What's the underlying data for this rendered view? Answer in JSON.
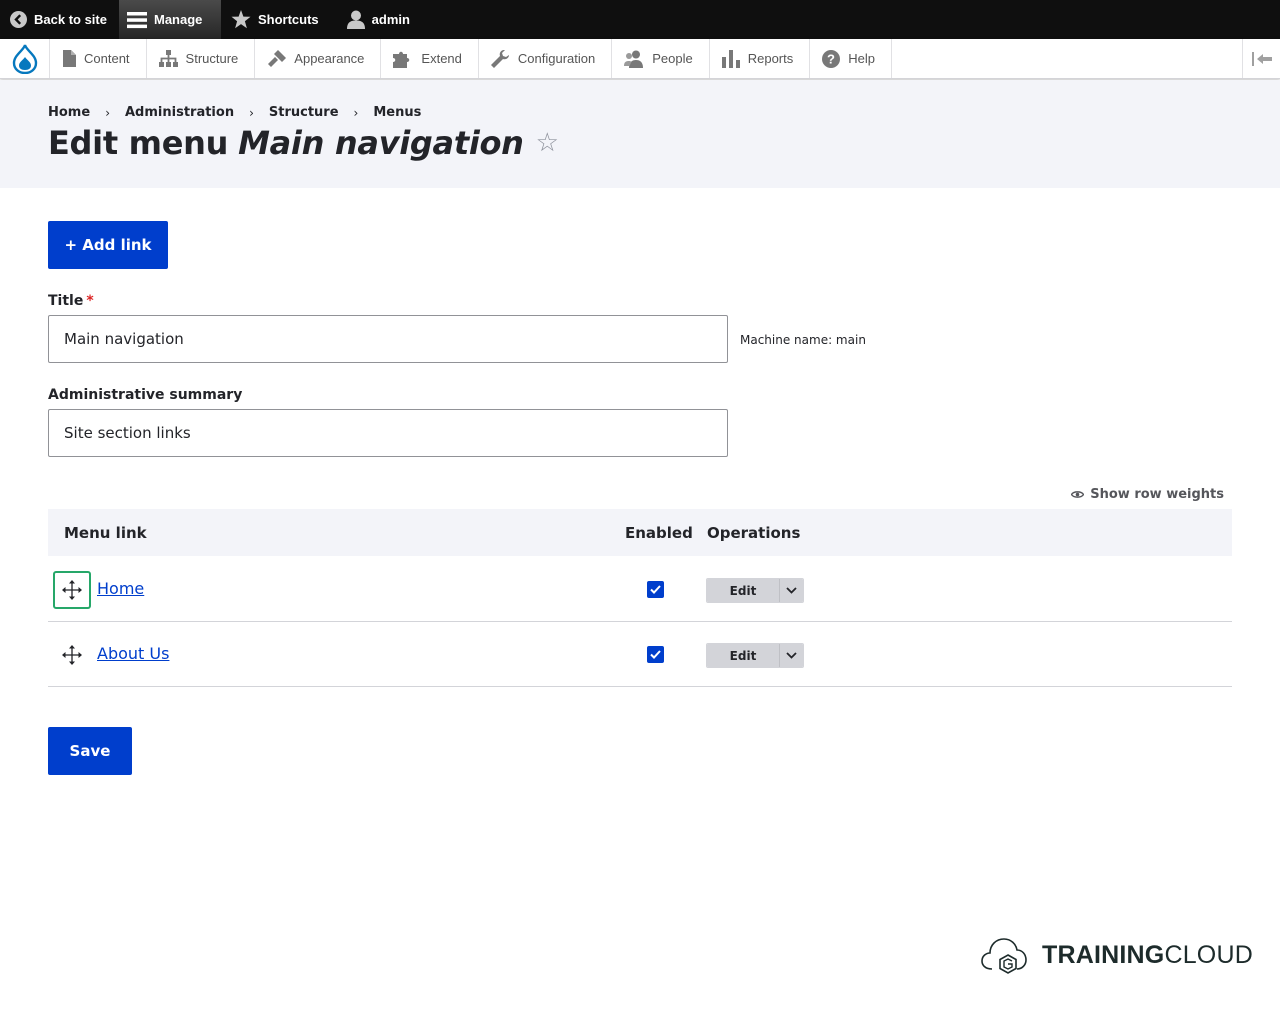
{
  "toolbar": {
    "back_to_site": "Back to site",
    "manage": "Manage",
    "shortcuts": "Shortcuts",
    "user": "admin"
  },
  "tray": {
    "items": [
      {
        "label": "Content",
        "icon": "file-icon"
      },
      {
        "label": "Structure",
        "icon": "sitemap-icon"
      },
      {
        "label": "Appearance",
        "icon": "paintbrush-icon"
      },
      {
        "label": "Extend",
        "icon": "puzzle-icon"
      },
      {
        "label": "Configuration",
        "icon": "wrench-icon"
      },
      {
        "label": "People",
        "icon": "people-icon"
      },
      {
        "label": "Reports",
        "icon": "bar-chart-icon"
      },
      {
        "label": "Help",
        "icon": "help-icon"
      }
    ]
  },
  "breadcrumb": [
    "Home",
    "Administration",
    "Structure",
    "Menus"
  ],
  "page": {
    "title_prefix": "Edit menu",
    "title_emph": "Main navigation",
    "star": "☆"
  },
  "actions": {
    "add_link": "+ Add link",
    "save": "Save"
  },
  "form": {
    "title_label": "Title",
    "title_required": "*",
    "title_value": "Main navigation",
    "machine_name": "Machine name: main",
    "summary_label": "Administrative summary",
    "summary_value": "Site section links"
  },
  "table": {
    "show_row_weights": "Show row weights",
    "headers": {
      "menu_link": "Menu link",
      "enabled": "Enabled",
      "operations": "Operations"
    },
    "rows": [
      {
        "link": "Home",
        "enabled": true,
        "edit": "Edit"
      },
      {
        "link": "About Us",
        "enabled": true,
        "edit": "Edit"
      }
    ]
  },
  "brand": {
    "part1": "TRAINING",
    "part2": "CLOUD"
  },
  "colors": {
    "primary": "#003ecc",
    "toolbar": "#0f0f0f",
    "header_bg": "#f3f4f9",
    "focus": "#26a769",
    "required": "#dc2323"
  }
}
